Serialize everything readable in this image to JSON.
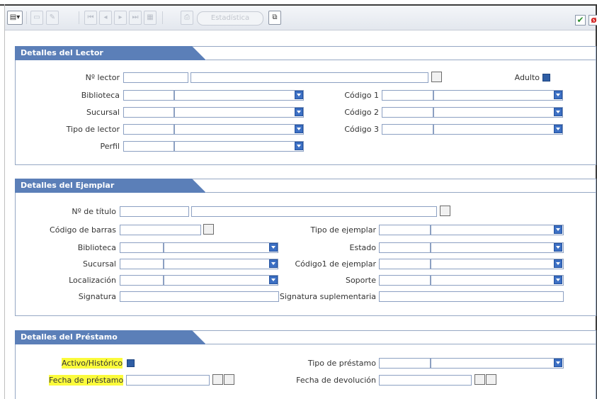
{
  "toolbar": {
    "stats_label": "Estadística",
    "ok_label": "✔",
    "cancel_label": "ø"
  },
  "lector": {
    "title": "Detalles del Lector",
    "lector_label": "Nº lector",
    "adulto_label": "Adulto",
    "biblioteca_label": "Biblioteca",
    "sucursal_label": "Sucursal",
    "tipo_lector_label": "Tipo de lector",
    "perfil_label": "Perfil",
    "codigo1_label": "Código 1",
    "codigo2_label": "Código 2",
    "codigo3_label": "Código 3"
  },
  "ejemplar": {
    "title": "Detalles del Ejemplar",
    "titulo_label": "Nº de título",
    "codigo_barras_label": "Código de barras",
    "biblioteca_label": "Biblioteca",
    "sucursal_label": "Sucursal",
    "localizacion_label": "Localización",
    "signatura_label": "Signatura",
    "tipo_ejemplar_label": "Tipo de ejemplar",
    "estado_label": "Estado",
    "codigo1_ejemplar_label": "Código1 de ejemplar",
    "soporte_label": "Soporte",
    "signatura_sup_label": "Signatura suplementaria"
  },
  "prestamo": {
    "title": "Detalles del Préstamo",
    "activo_label": "Activo/Histórico",
    "fecha_prestamo_label": "Fecha de préstamo",
    "tipo_prestamo_label": "Tipo de préstamo",
    "fecha_devolucion_label": "Fecha de devolución"
  },
  "colors": {
    "section_header": "#5b7fb8",
    "highlight": "#fbfb3c",
    "dropdown_button": "#3d70c4"
  }
}
